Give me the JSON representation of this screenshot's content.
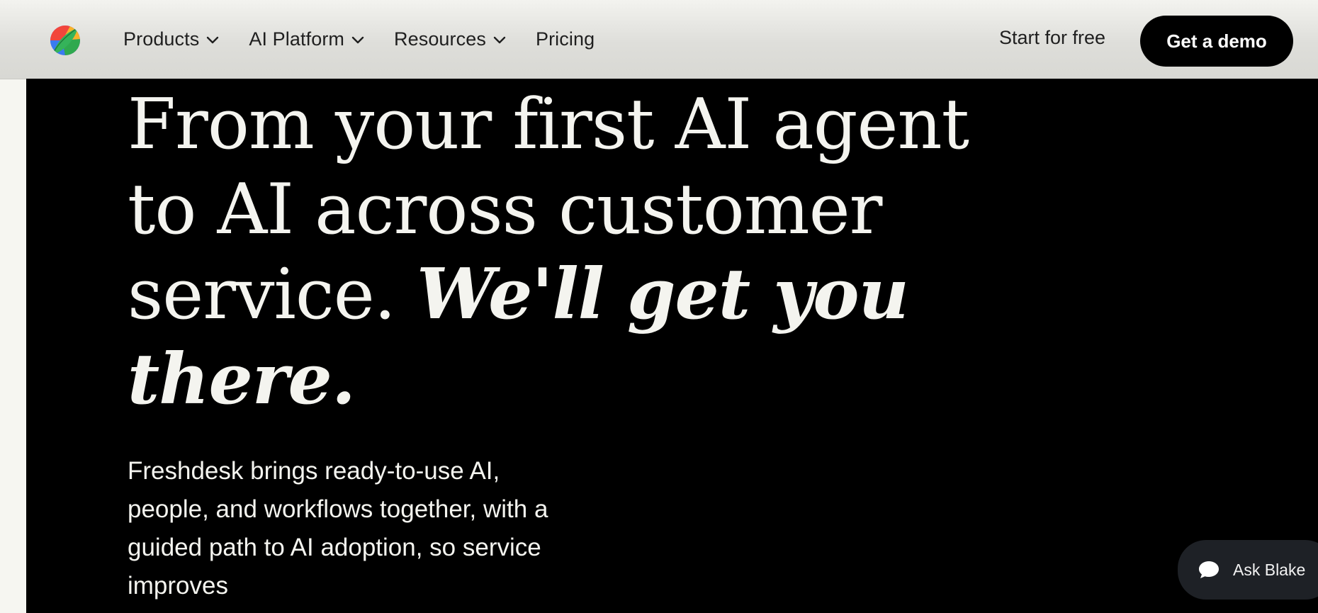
{
  "header": {
    "logo_icon": "freshdesk-logo-icon",
    "nav": [
      {
        "label": "Products",
        "has_dropdown": true
      },
      {
        "label": "AI Platform",
        "has_dropdown": true
      },
      {
        "label": "Resources",
        "has_dropdown": true
      },
      {
        "label": "Pricing",
        "has_dropdown": false
      }
    ],
    "start_free_label": "Start for free",
    "demo_label": "Get a demo"
  },
  "hero": {
    "headline_regular": "From your first AI agent to AI across customer service.",
    "headline_emphasis": "We'll get you there.",
    "subcopy": "Freshdesk brings ready-to-use AI, people, and workflows together, with a guided path to AI adoption, so service improves"
  },
  "chat": {
    "label": "Ask Blake",
    "icon": "chat-bubble-icon"
  },
  "colors": {
    "hero_bg": "#000000",
    "hero_text": "#f4f4ef",
    "button_bg": "#000000",
    "chat_bg": "#1e2126"
  }
}
